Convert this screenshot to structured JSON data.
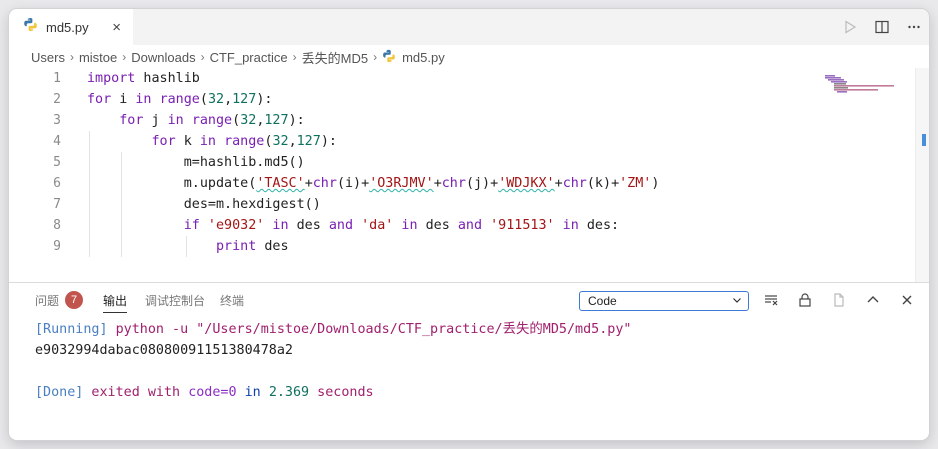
{
  "tab": {
    "title": "md5.py",
    "close": "×"
  },
  "breadcrumb": [
    "Users",
    "mistoe",
    "Downloads",
    "CTF_practice",
    "丢失的MD5",
    "md5.py"
  ],
  "breadcrumb_sep": "›",
  "editor": {
    "line_numbers": [
      "1",
      "2",
      "3",
      "4",
      "5",
      "6",
      "7",
      "8",
      "9"
    ],
    "code": {
      "l1": {
        "kw": "import",
        "rest": " hashlib"
      },
      "l2": {
        "kw": "for",
        "a": " i ",
        "in": "in",
        "fn": "range",
        "p1": "(",
        "n1": "32",
        "c": ",",
        "n2": "127",
        "p2": "):"
      },
      "l3": {
        "kw": "for",
        "a": " j ",
        "in": "in",
        "fn": "range",
        "p1": "(",
        "n1": "32",
        "c": ",",
        "n2": "127",
        "p2": "):"
      },
      "l4": {
        "kw": "for",
        "a": " k ",
        "in": "in",
        "fn": "range",
        "p1": "(",
        "n1": "32",
        "c": ",",
        "n2": "127",
        "p2": "):"
      },
      "l5": {
        "text": "m=hashlib.md5()"
      },
      "l6": {
        "a": "m.update(",
        "s1": "'TASC'",
        "plus1": "+",
        "f1": "chr",
        "v1": "(i)",
        "plus2": "+",
        "s2": "'O3RJMV'",
        "plus3": "+",
        "f2": "chr",
        "v2": "(j)",
        "plus4": "+",
        "s3": "'WDJKX'",
        "plus5": "+",
        "f3": "chr",
        "v3": "(k)",
        "plus6": "+",
        "s4": "'ZM'",
        "end": ")"
      },
      "l7": {
        "text": "des=m.hexdigest()"
      },
      "l8": {
        "kw": "if",
        "s1": " 'e9032'",
        "in1": " in",
        "v1": " des ",
        "and1": "and",
        "s2": " 'da'",
        "in2": " in",
        "v2": " des ",
        "and2": "and",
        "s3": " '911513'",
        "in3": " in",
        "v3": " des:"
      },
      "l9": {
        "kw": "print",
        "rest": " des"
      }
    }
  },
  "panel": {
    "tabs": [
      {
        "label": "问题",
        "badge": "7"
      },
      {
        "label": "输出"
      },
      {
        "label": "调试控制台"
      },
      {
        "label": "终端"
      }
    ],
    "dropdown_value": "Code",
    "output": {
      "running_tag": "[Running]",
      "running_cmd": " python -u \"/Users/mistoe/Downloads/CTF_practice/丢失的MD5/md5.py\"",
      "result": "e9032994dabac08080091151380478a2",
      "done_tag": "[Done]",
      "exited": " exited with ",
      "code": "code=0",
      "in": " in ",
      "time": "2.369",
      "seconds": " seconds"
    }
  }
}
